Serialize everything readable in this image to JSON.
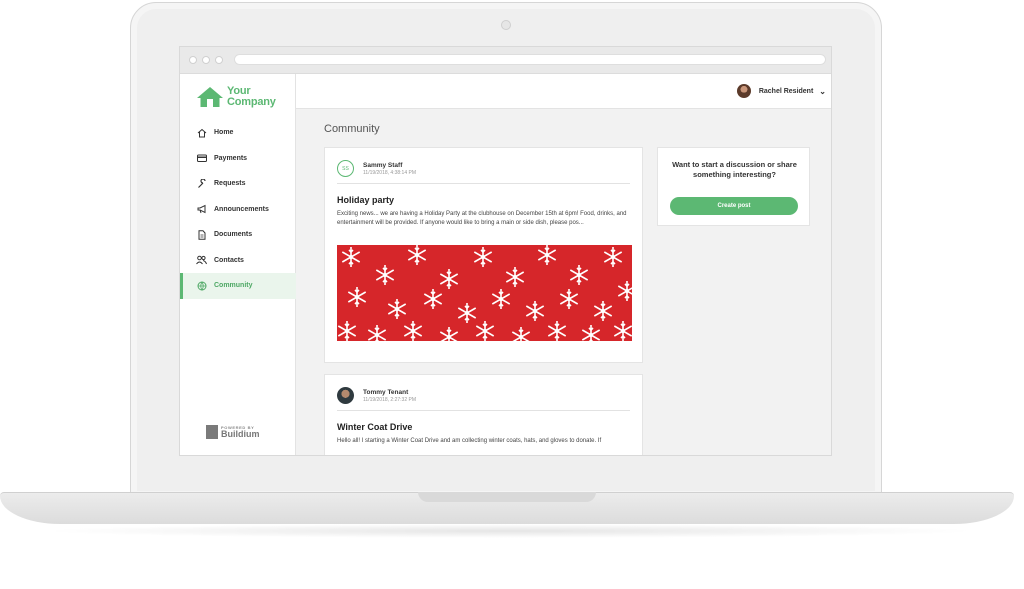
{
  "brand": {
    "line1": "Your",
    "line2": "Company",
    "powered_small": "POWERED BY",
    "powered_big": "Buildium",
    "accent": "#5cb873"
  },
  "sidebar": {
    "items": [
      {
        "label": "Home",
        "icon": "home-icon"
      },
      {
        "label": "Payments",
        "icon": "credit-card-icon"
      },
      {
        "label": "Requests",
        "icon": "wrench-icon"
      },
      {
        "label": "Announcements",
        "icon": "megaphone-icon"
      },
      {
        "label": "Documents",
        "icon": "document-icon"
      },
      {
        "label": "Contacts",
        "icon": "contacts-icon"
      },
      {
        "label": "Community",
        "icon": "globe-icon",
        "active": true
      }
    ]
  },
  "header": {
    "user_name": "Rachel Resident"
  },
  "main": {
    "title": "Community",
    "posts": [
      {
        "initials": "SS",
        "author": "Sammy Staff",
        "date": "11/19/2018, 4:38:14 PM",
        "title": "Holiday party",
        "body": "Exciting news... we are having a Holiday Party at the clubhouse on December 15th at 6pm! Food, drinks, and entertainment will be provided. If anyone would like to bring a main or side dish, please pos..."
      },
      {
        "author": "Tommy Tenant",
        "date": "11/19/2018, 2:27:32 PM",
        "title": "Winter Coat Drive",
        "body": "Hello all! I starting a Winter Coat Drive and am collecting winter coats, hats, and gloves to donate. If"
      }
    ],
    "side_card": {
      "question": "Want to start a discussion or share something interesting?",
      "button": "Create post"
    }
  }
}
